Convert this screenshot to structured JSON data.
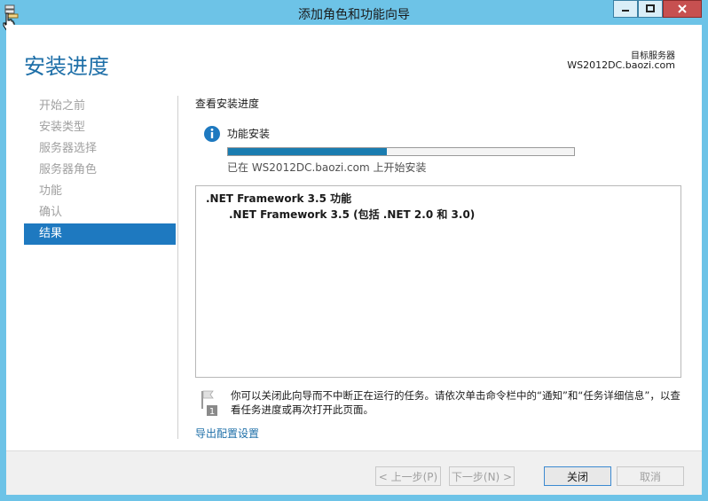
{
  "window": {
    "title": "添加角色和功能向导"
  },
  "header": {
    "title": "安装进度",
    "dest_label": "目标服务器",
    "dest_value": "WS2012DC.baozi.com"
  },
  "nav": {
    "items": [
      {
        "label": "开始之前"
      },
      {
        "label": "安装类型"
      },
      {
        "label": "服务器选择"
      },
      {
        "label": "服务器角色"
      },
      {
        "label": "功能"
      },
      {
        "label": "确认"
      },
      {
        "label": "结果"
      }
    ],
    "active_index": 6
  },
  "content": {
    "heading": "查看安装进度",
    "progress_label": "功能安装",
    "progress_fraction": 0.46,
    "status": "已在 WS2012DC.baozi.com 上开始安装",
    "features": [
      {
        "name": ".NET Framework 3.5 功能",
        "sub": ".NET Framework 3.5 (包括 .NET 2.0 和 3.0)"
      }
    ],
    "notice": "你可以关闭此向导而不中断正在运行的任务。请依次单击命令栏中的“通知”和“任务详细信息”，以查看任务进度或再次打开此页面。",
    "export_link": "导出配置设置"
  },
  "footer": {
    "prev_label": "< 上一步(P)",
    "next_label": "下一步(N) >",
    "close_label": "关闭",
    "cancel_label": "取消"
  },
  "colors": {
    "titlebar": "#6dc3e7",
    "accent": "#1e79c0",
    "progress": "#1a7cb0",
    "close_button": "#c75050"
  }
}
